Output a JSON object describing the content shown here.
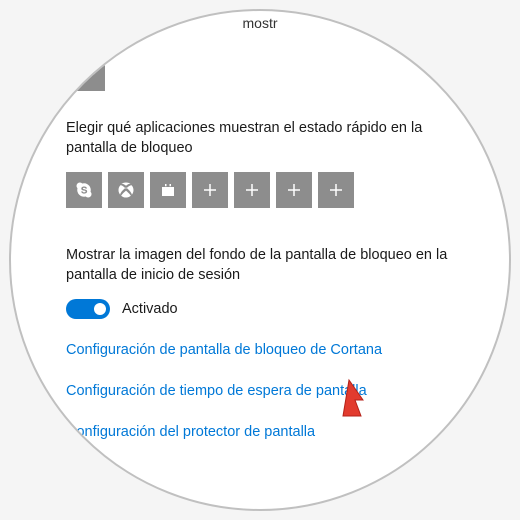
{
  "top_fragment": "mostr",
  "quick_status": {
    "label": "Elegir qué aplicaciones muestran el estado rápido en la pantalla de bloqueo",
    "apps": [
      {
        "name": "skype",
        "icon": "skype"
      },
      {
        "name": "xbox",
        "icon": "xbox"
      },
      {
        "name": "store",
        "icon": "store"
      },
      {
        "name": "empty1",
        "icon": "plus"
      },
      {
        "name": "empty2",
        "icon": "plus"
      },
      {
        "name": "empty3",
        "icon": "plus"
      },
      {
        "name": "empty4",
        "icon": "plus"
      }
    ]
  },
  "background_toggle": {
    "label": "Mostrar la imagen del fondo de la pantalla de bloqueo en la pantalla de inicio de sesión",
    "state_label": "Activado",
    "value": true
  },
  "links": {
    "cortana": "Configuración de pantalla de bloqueo de Cortana",
    "timeout": "Configuración de tiempo de espera de pantalla",
    "screensaver": "Configuración del protector de pantalla"
  },
  "colors": {
    "accent": "#0078d7",
    "tile": "#8d8d8d",
    "cursor": "#e23b2e"
  }
}
